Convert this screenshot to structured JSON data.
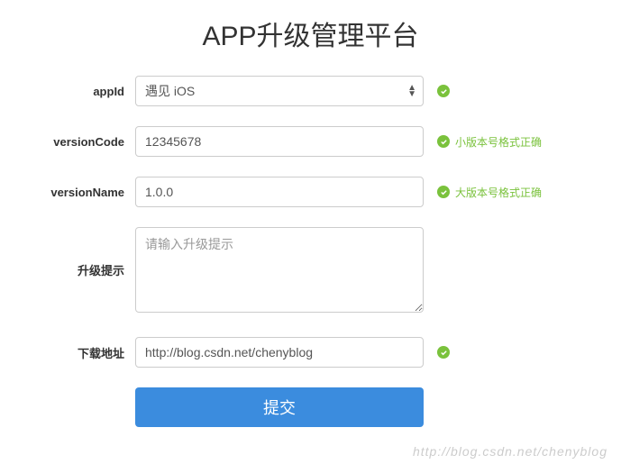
{
  "title": "APP升级管理平台",
  "form": {
    "appId": {
      "label": "appId",
      "selected": "遇见 iOS"
    },
    "versionCode": {
      "label": "versionCode",
      "value": "12345678",
      "validation": "小版本号格式正确"
    },
    "versionName": {
      "label": "versionName",
      "value": "1.0.0",
      "validation": "大版本号格式正确"
    },
    "upgradeTip": {
      "label": "升级提示",
      "placeholder": "请输入升级提示"
    },
    "downloadUrl": {
      "label": "下载地址",
      "value": "http://blog.csdn.net/chenyblog"
    },
    "submit": "提交"
  },
  "watermark": "http://blog.csdn.net/chenyblog"
}
